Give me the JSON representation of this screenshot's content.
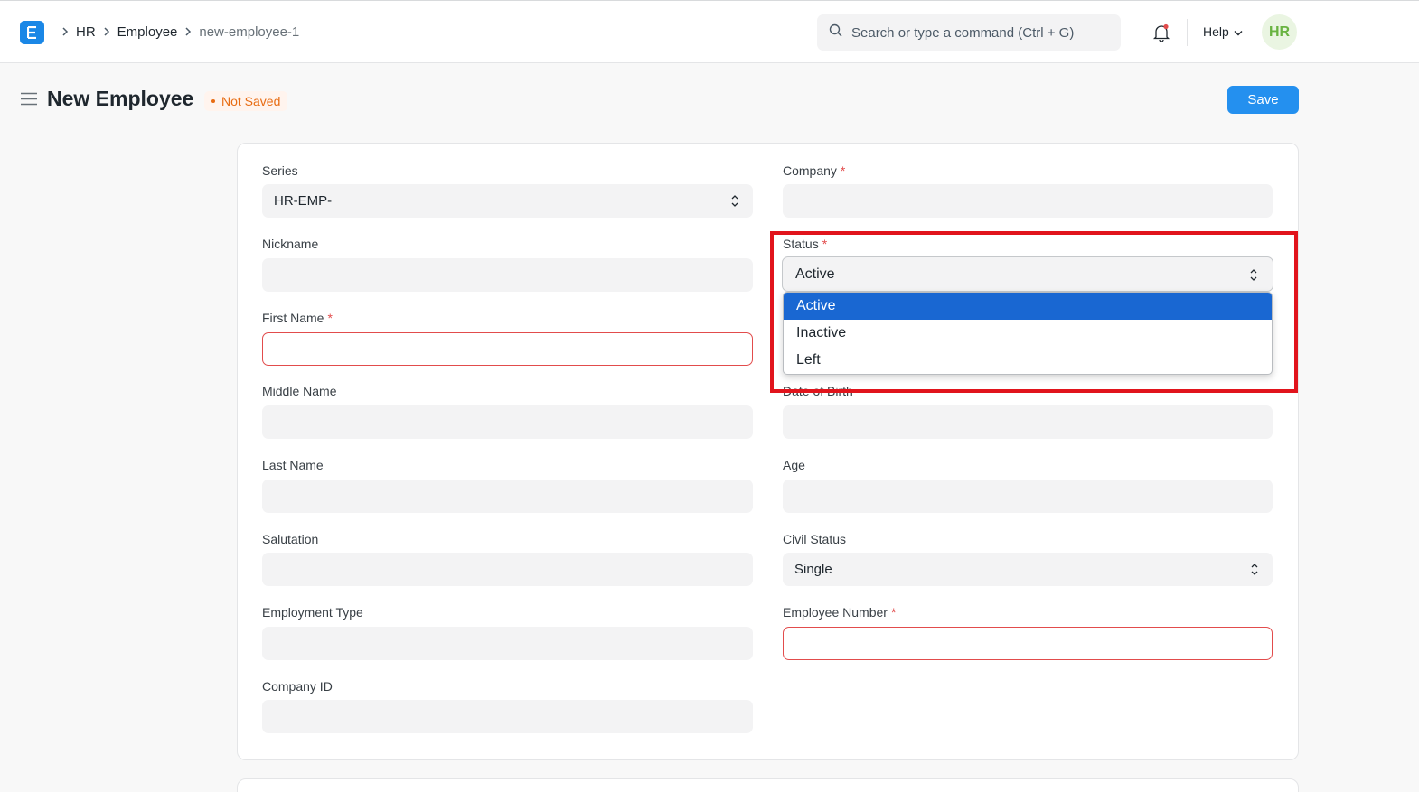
{
  "navbar": {
    "breadcrumbs": [
      "HR",
      "Employee",
      "new-employee-1"
    ],
    "search_placeholder": "Search or type a command (Ctrl + G)",
    "help_label": "Help",
    "avatar_initials": "HR"
  },
  "page": {
    "title": "New Employee",
    "status_badge": "Not Saved",
    "save_label": "Save"
  },
  "form": {
    "left": [
      {
        "label": "Series",
        "value": "HR-EMP-",
        "required": false
      },
      {
        "label": "Nickname",
        "value": "",
        "required": false
      },
      {
        "label": "First Name",
        "value": "",
        "required": true
      },
      {
        "label": "Middle Name",
        "value": "",
        "required": false
      },
      {
        "label": "Last Name",
        "value": "",
        "required": false
      },
      {
        "label": "Salutation",
        "value": "",
        "required": false
      },
      {
        "label": "Employment Type",
        "value": "",
        "required": false
      },
      {
        "label": "Company ID",
        "value": "",
        "required": false
      }
    ],
    "right": [
      {
        "label": "Company",
        "value": "",
        "required": true
      },
      {
        "label": "Status",
        "value": "Active",
        "required": true
      },
      {
        "label": "Date of Birth",
        "value": "",
        "required": false
      },
      {
        "label": "Age",
        "value": "",
        "required": false
      },
      {
        "label": "Civil Status",
        "value": "Single",
        "required": false
      },
      {
        "label": "Employee Number",
        "value": "",
        "required": true
      }
    ],
    "required_mark": "*"
  },
  "status_dropdown": {
    "options": [
      "Active",
      "Inactive",
      "Left"
    ],
    "selected": "Active"
  },
  "colors": {
    "primary": "#2490ef",
    "error": "#e24c4c",
    "highlight": "#e1141c",
    "selected_option": "#1967d2"
  }
}
